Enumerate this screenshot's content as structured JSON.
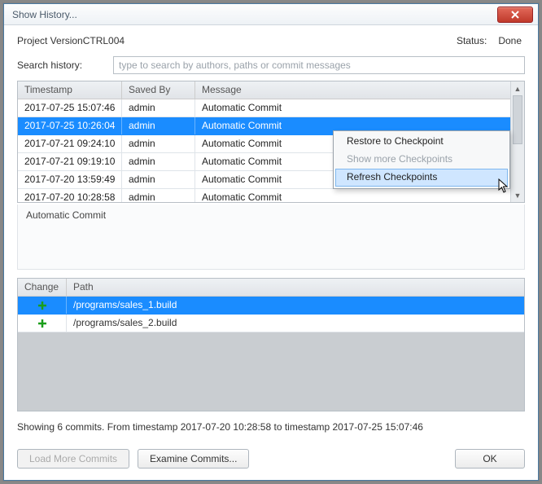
{
  "window": {
    "title": "Show History..."
  },
  "header": {
    "project": "Project VersionCTRL004",
    "status_label": "Status:",
    "status_value": "Done"
  },
  "search": {
    "label": "Search history:",
    "placeholder": "type to search by authors, paths or commit messages",
    "value": ""
  },
  "history_table": {
    "columns": {
      "timestamp": "Timestamp",
      "saved_by": "Saved By",
      "message": "Message"
    },
    "rows": [
      {
        "timestamp": "2017-07-25 15:07:46",
        "saved_by": "admin",
        "message": "Automatic Commit",
        "selected": false
      },
      {
        "timestamp": "2017-07-25 10:26:04",
        "saved_by": "admin",
        "message": "Automatic Commit",
        "selected": true
      },
      {
        "timestamp": "2017-07-21 09:24:10",
        "saved_by": "admin",
        "message": "Automatic Commit",
        "selected": false
      },
      {
        "timestamp": "2017-07-21 09:19:10",
        "saved_by": "admin",
        "message": "Automatic Commit",
        "selected": false
      },
      {
        "timestamp": "2017-07-20 13:59:49",
        "saved_by": "admin",
        "message": "Automatic Commit",
        "selected": false
      },
      {
        "timestamp": "2017-07-20 10:28:58",
        "saved_by": "admin",
        "message": "Automatic Commit",
        "selected": false
      }
    ]
  },
  "commit_message": "Automatic Commit",
  "changes_table": {
    "columns": {
      "change": "Change",
      "path": "Path"
    },
    "rows": [
      {
        "change_icon": "plus-icon",
        "path": "/programs/sales_1.build",
        "selected": true
      },
      {
        "change_icon": "plus-icon",
        "path": "/programs/sales_2.build",
        "selected": false
      }
    ]
  },
  "summary": "Showing 6 commits. From timestamp 2017-07-20 10:28:58  to timestamp  2017-07-25 15:07:46",
  "buttons": {
    "load_more": "Load More Commits",
    "examine": "Examine Commits...",
    "ok": "OK"
  },
  "context_menu": {
    "items": [
      {
        "label": "Restore to Checkpoint",
        "enabled": true,
        "hover": false
      },
      {
        "label": "Show more Checkpoints",
        "enabled": false,
        "hover": false
      },
      {
        "label": "Refresh Checkpoints",
        "enabled": true,
        "hover": true
      }
    ]
  }
}
